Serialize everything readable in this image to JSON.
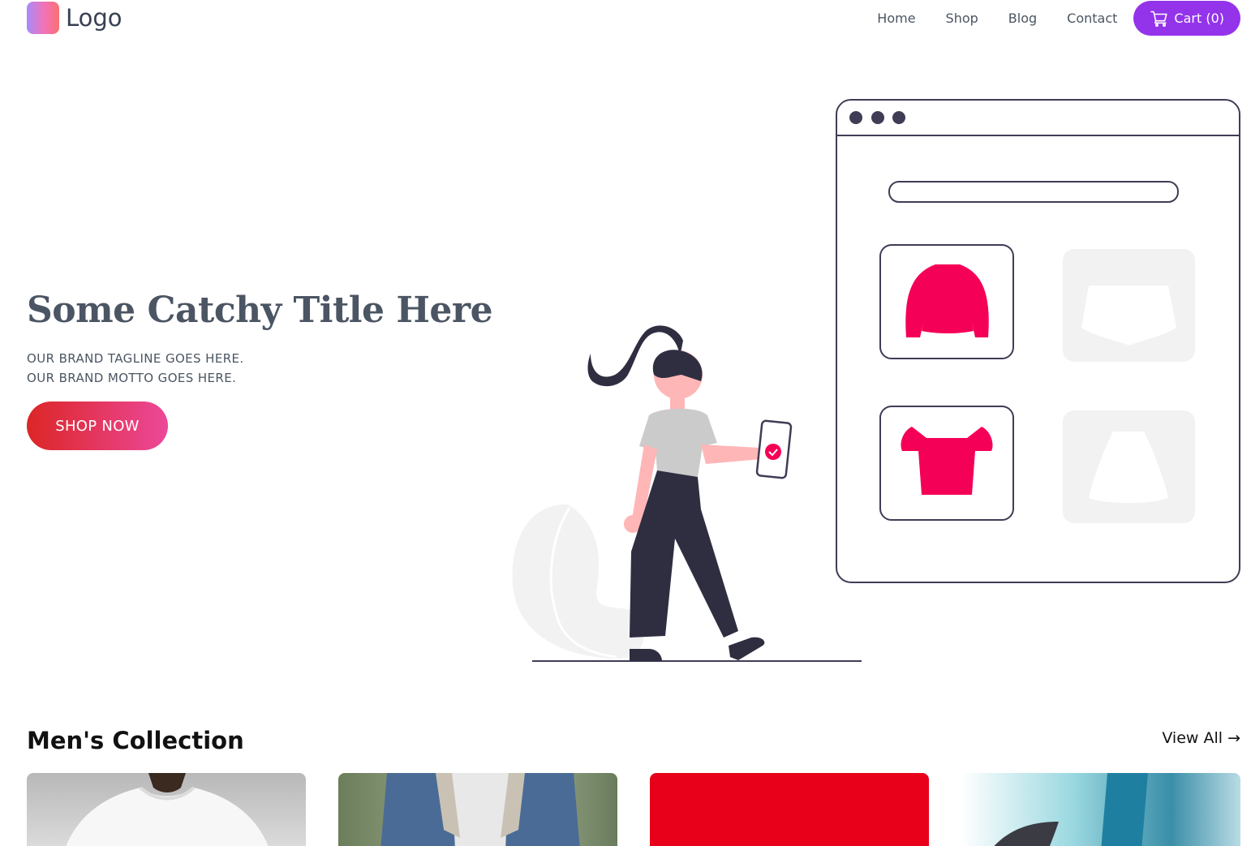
{
  "header": {
    "logo_text": "Logo",
    "nav": [
      {
        "label": "Home"
      },
      {
        "label": "Shop"
      },
      {
        "label": "Blog"
      },
      {
        "label": "Contact"
      }
    ],
    "cart_label": "Cart (0)"
  },
  "hero": {
    "title": "Some Catchy Title Here",
    "tagline_1": "OUR BRAND TAGLINE GOES HERE.",
    "tagline_2": "OUR BRAND MOTTO GOES HERE.",
    "cta_label": "SHOP NOW"
  },
  "collection": {
    "title": "Men's Collection",
    "view_all_label": "View All →"
  },
  "colors": {
    "accent_purple": "#9333ea",
    "cta_gradient_start": "#dc2626",
    "cta_gradient_end": "#ec4899",
    "illustration_pink": "#f50057",
    "illustration_dark": "#3f3d56"
  }
}
